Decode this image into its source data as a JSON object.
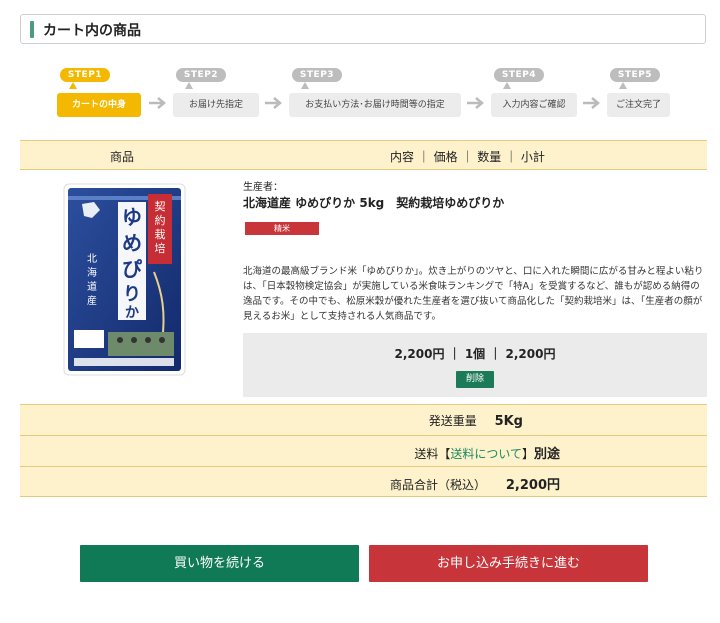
{
  "header": {
    "title": "カート内の商品"
  },
  "steps": [
    {
      "badge": "STEP1",
      "label": "カートの中身",
      "active": true
    },
    {
      "badge": "STEP2",
      "label": "お届け先指定",
      "active": false
    },
    {
      "badge": "STEP3",
      "label": "お支払い方法･お届け時間等の指定",
      "active": false
    },
    {
      "badge": "STEP4",
      "label": "入力内容ご確認",
      "active": false
    },
    {
      "badge": "STEP5",
      "label": "ご注文完了",
      "active": false
    }
  ],
  "table_header": {
    "product": "商品",
    "cols": "内容 ｜ 価格 ｜ 数量 ｜ 小計"
  },
  "item": {
    "image_label": "ゆめぴりか",
    "image_banner": "契約栽培米",
    "image_side": "北海道産",
    "producer_label": "生産者：",
    "name": "北海道産 ゆめぴりか 5kg　契約栽培ゆめぴりか",
    "tag": "精米",
    "description": "北海道の最高級ブランド米「ゆめぴりか」。炊き上がりのツヤと、口に入れた瞬間に広がる甘みと程よい粘りは、「日本穀物検定協会」が実施している米食味ランキングで「特A」を受賞するなど、誰もが認める納得の逸品です。その中でも、松原米穀が優れた生産者を選び抜いて商品化した「契約栽培米」は、「生産者の顔が見えるお米」として支持される人気商品です。",
    "price_line": "2,200円 ｜ 1個 ｜ 2,200円",
    "delete_label": "削除"
  },
  "summary": {
    "weight_label": "発送重量",
    "weight_value": "5Kg",
    "shipping_prefix": "送料【",
    "shipping_link": "送料について",
    "shipping_suffix": "】",
    "shipping_value": "別途",
    "total_label": "商品合計（税込）",
    "total_value": "2,200円"
  },
  "buttons": {
    "continue": "買い物を続ける",
    "checkout": "お申し込み手続きに進む"
  },
  "colors": {
    "accent_yellow": "#f5b800",
    "row_bg": "#fdf2cc",
    "green": "#0f7a55",
    "red": "#c7343a"
  }
}
